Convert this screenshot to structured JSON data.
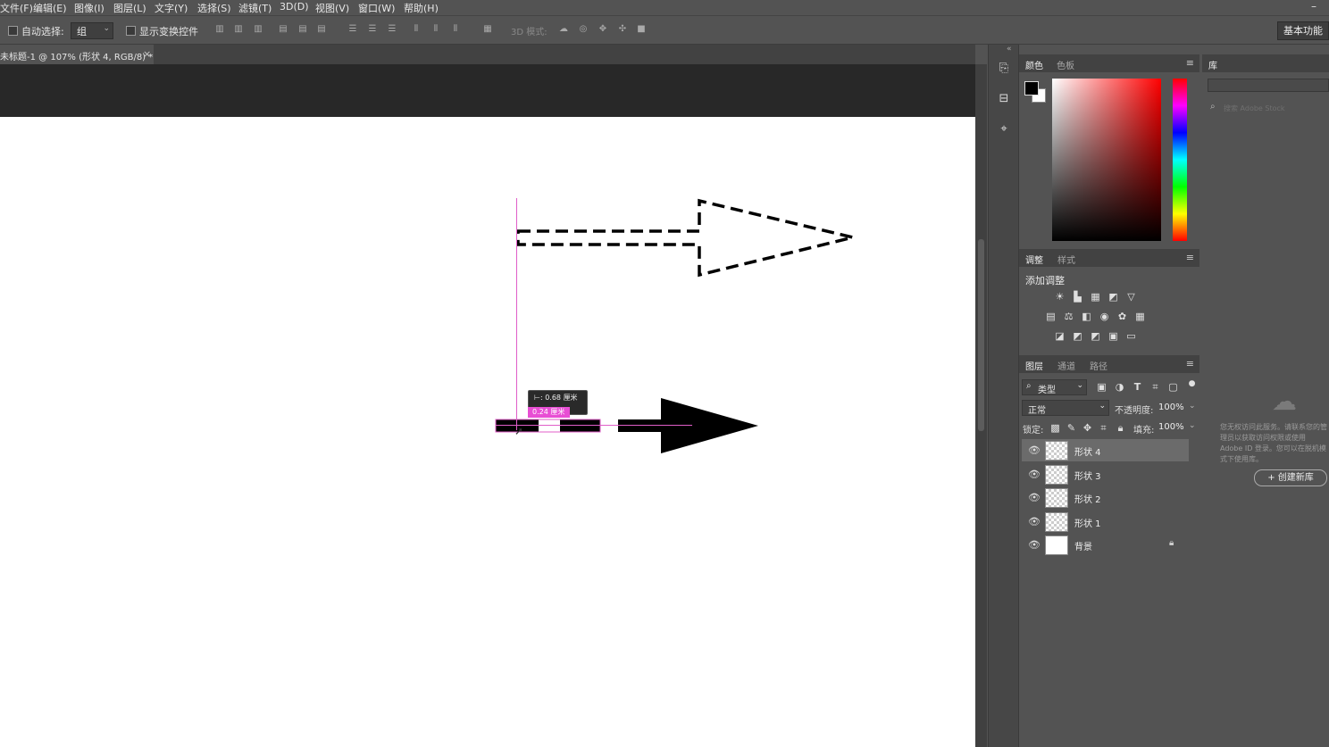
{
  "menu": [
    "文件(F)",
    "编辑(E)",
    "图像(I)",
    "图层(L)",
    "文字(Y)",
    "选择(S)",
    "滤镜(T)",
    "3D(D)",
    "视图(V)",
    "窗口(W)",
    "帮助(H)"
  ],
  "options": {
    "auto_select_label": "自动选择:",
    "group_value": "组",
    "show_transform_label": "显示变换控件",
    "mode_3d_label": "3D 模式:",
    "workspace_label": "基本功能"
  },
  "document": {
    "tab_title": "未标题-1 @ 107% (形状 4, RGB/8) *",
    "close": "×"
  },
  "canvas": {
    "tooltip": "⊢: 0.68 厘米",
    "measure": "0.24 厘米"
  },
  "color_panel": {
    "tabs": [
      "颜色",
      "色板"
    ],
    "fg_color": "#000000",
    "bg_color": "#ffffff"
  },
  "adjust_panel": {
    "tabs": [
      "调整",
      "样式"
    ],
    "title": "添加调整"
  },
  "layers_panel": {
    "tabs": [
      "图层",
      "通道",
      "路径"
    ],
    "filter_kind": "类型",
    "blend_mode": "正常",
    "opacity_label": "不透明度:",
    "opacity_value": "100%",
    "lock_label": "锁定:",
    "fill_label": "填充:",
    "fill_value": "100%",
    "layers": [
      {
        "name": "形状 4",
        "selected": true
      },
      {
        "name": "形状 3",
        "selected": false
      },
      {
        "name": "形状 2",
        "selected": false
      },
      {
        "name": "形状 1",
        "selected": false
      },
      {
        "name": "背景",
        "selected": false,
        "locked": true
      }
    ]
  },
  "library_panel": {
    "tab": "库",
    "search_placeholder": "搜索 Adobe Stock",
    "message": "您无权访问此服务。请联系您的管理员以获取访问权限或使用 Adobe ID 登录。您可以在脱机模式下使用库。",
    "create_button": "+ 创建新库"
  }
}
